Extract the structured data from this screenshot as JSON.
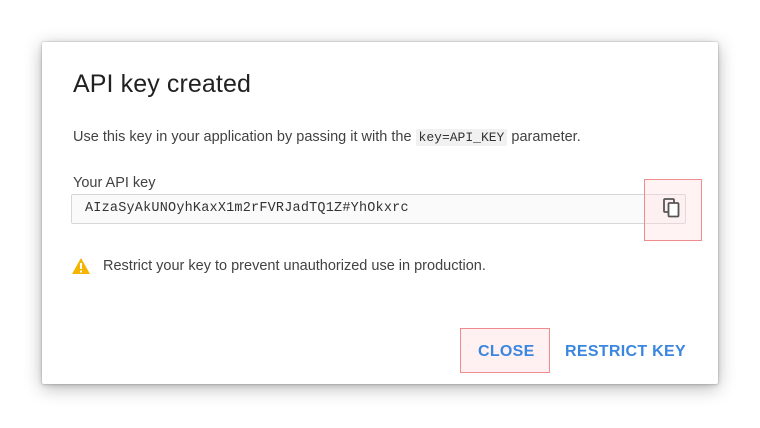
{
  "dialog": {
    "title": "API key created",
    "description_before": "Use this key in your application by passing it with the ",
    "description_code": "key=API_KEY",
    "description_after": " parameter.",
    "field_label": "Your API key",
    "api_key_value": "AIzaSyAkUNOyhKaxX1m2rFVRJadTQ1Z#YhOkxrc",
    "warning_text": "Restrict your key to prevent unauthorized use in production.",
    "close_label": "CLOSE",
    "restrict_label": "RESTRICT KEY"
  },
  "icons": {
    "copy": "copy-icon",
    "warning": "warning-icon"
  },
  "colors": {
    "accent": "#3b86e0",
    "warning": "#f4b400",
    "highlight_border": "#ef8b8b"
  }
}
